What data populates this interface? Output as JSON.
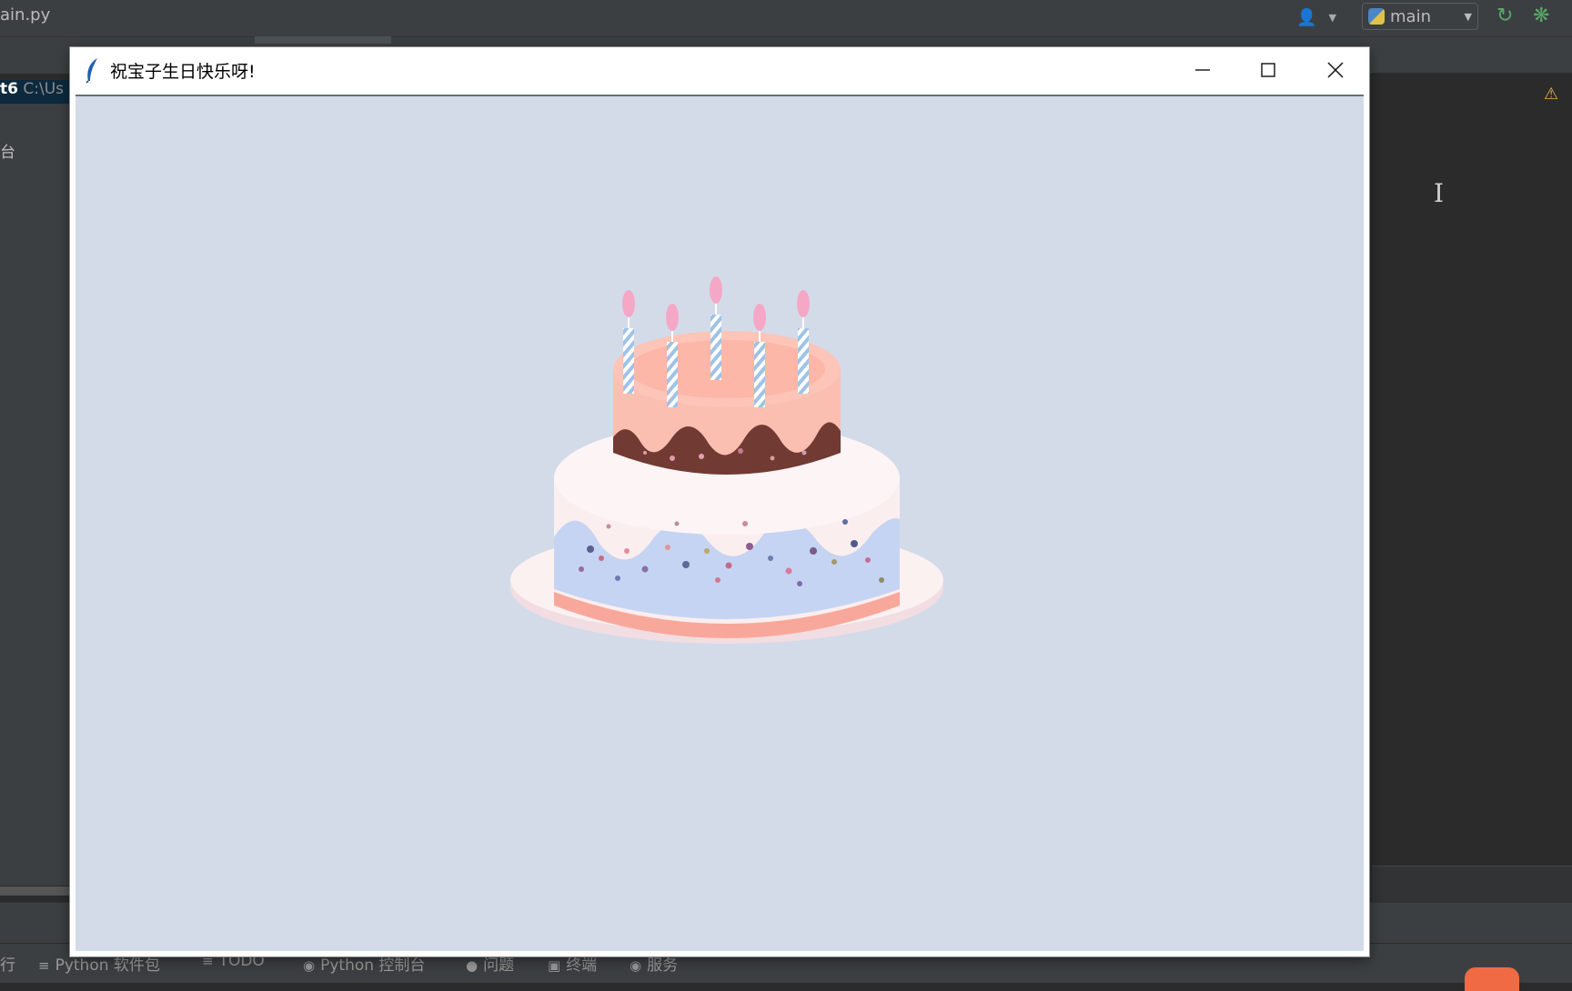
{
  "ide": {
    "file_title": "ain.py",
    "run_config": "main",
    "project_name": "t6",
    "project_path": "C:\\Us",
    "side_tab_label": "台",
    "bottom_first_label": "行",
    "tool_windows": [
      {
        "icon": "layers-icon",
        "label": "Python 软件包"
      },
      {
        "icon": "list-icon",
        "label": "TODO"
      },
      {
        "icon": "python-icon",
        "label": "Python 控制台"
      },
      {
        "icon": "info-icon",
        "label": "问题"
      },
      {
        "icon": "terminal-icon",
        "label": "终端"
      },
      {
        "icon": "services-icon",
        "label": "服务"
      }
    ]
  },
  "tk_window": {
    "title": "祝宝子生日快乐呀!",
    "canvas_color": "#d3dbe9",
    "buttons": [
      "minimize",
      "maximize",
      "close"
    ]
  },
  "cake": {
    "candles": 5,
    "colors": {
      "plate": "#fcf1f1",
      "bottom_tier": "#fbeeee",
      "blue_frosting": "#c6d4f3",
      "coral_band": "#f8a89b",
      "top_tier": "#fbbfb1",
      "chocolate": "#713a32",
      "candle_stripe": "#9ec3e6",
      "flame": "#f5a8c6"
    }
  }
}
